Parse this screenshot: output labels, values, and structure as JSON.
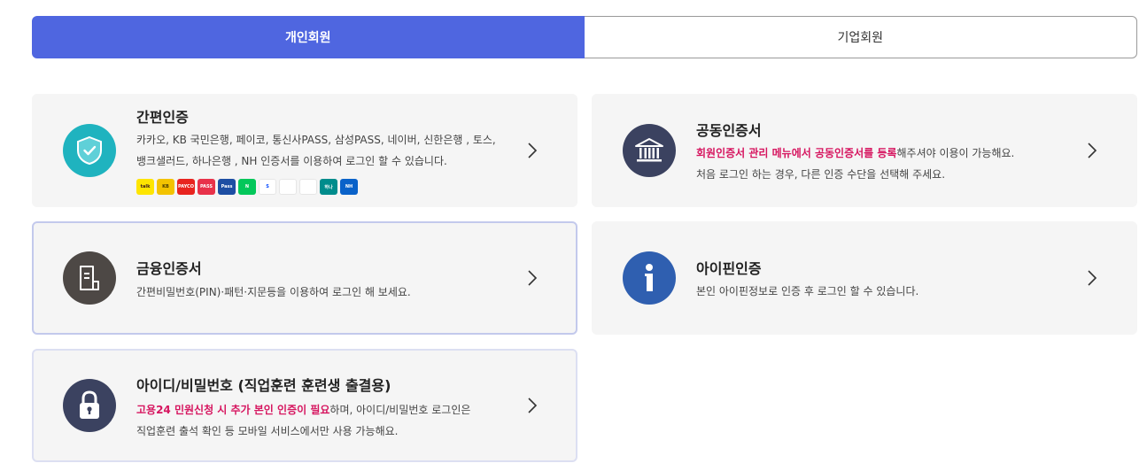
{
  "tabs": {
    "personal": "개인회원",
    "corporate": "기업회원"
  },
  "cards": {
    "simple": {
      "title": "간편인증",
      "desc_line1": "카카오, KB 국민은행, 페이코, 통신사PASS, 삼성PASS, 네이버, 신한은행 , 토스,",
      "desc_line2": "뱅크샐러드, 하나은행 , NH 인증서를 이용하여 로그인 할 수 있습니다.",
      "logos": [
        {
          "name": "kakao-logo",
          "label": "talk",
          "bg": "#fee500",
          "fg": "#3c1e1e"
        },
        {
          "name": "kb-logo",
          "label": "KB",
          "bg": "#f3c300",
          "fg": "#4a3b00"
        },
        {
          "name": "payco-logo",
          "label": "PAYCO",
          "bg": "#e8241f",
          "fg": "#ffffff"
        },
        {
          "name": "pass-logo",
          "label": "PASS",
          "bg": "#e8324a",
          "fg": "#ffffff"
        },
        {
          "name": "samsung-pass-logo",
          "label": "Pass",
          "bg": "#1d4ea3",
          "fg": "#ffffff"
        },
        {
          "name": "naver-logo",
          "label": "N",
          "bg": "#03c75a",
          "fg": "#ffffff"
        },
        {
          "name": "shinhan-logo",
          "label": "S",
          "bg": "#ffffff",
          "fg": "#0046ff"
        },
        {
          "name": "toss-logo",
          "label": "",
          "bg": "#ffffff",
          "fg": "#0064ff"
        },
        {
          "name": "banksalad-logo",
          "label": "",
          "bg": "#ffffff",
          "fg": "#14c4a1"
        },
        {
          "name": "hana-logo",
          "label": "하나",
          "bg": "#008c8c",
          "fg": "#ffffff"
        },
        {
          "name": "nh-logo",
          "label": "NH",
          "bg": "#0a62c9",
          "fg": "#ffffff"
        }
      ]
    },
    "joint": {
      "title": "공동인증서",
      "desc_hl": "회원인증서 관리 메뉴에서 공동인증서를 등록",
      "desc_rest": "해주셔야 이용이 가능해요.",
      "desc_line2": "처음 로그인 하는 경우, 다른 인증 수단을 선택해 주세요."
    },
    "financial": {
      "title": "금융인증서",
      "desc": "간편비밀번호(PIN)·패턴·지문등을 이용하여 로그인 해 보세요."
    },
    "ipin": {
      "title": "아이핀인증",
      "desc": "본인 아이핀정보로 인증 후 로그인 할 수 있습니다."
    },
    "idpw": {
      "title": "아이디/비밀번호 (직업훈련 훈련생 출결용)",
      "desc_hl": "고용24 민원신청 시 추가 본인 인증이 필요",
      "desc_rest": "하며, 아이디/비밀번호 로그인은",
      "desc_line2": "직업훈련 출석 확인 등 모바일 서비스에서만 사용 가능해요."
    }
  },
  "colors": {
    "accent": "#4f66e0",
    "highlight": "#d6155f",
    "teal": "#1fb3bf",
    "navy": "#3b4260",
    "brown": "#4d4845",
    "blue": "#2f5fb0"
  }
}
